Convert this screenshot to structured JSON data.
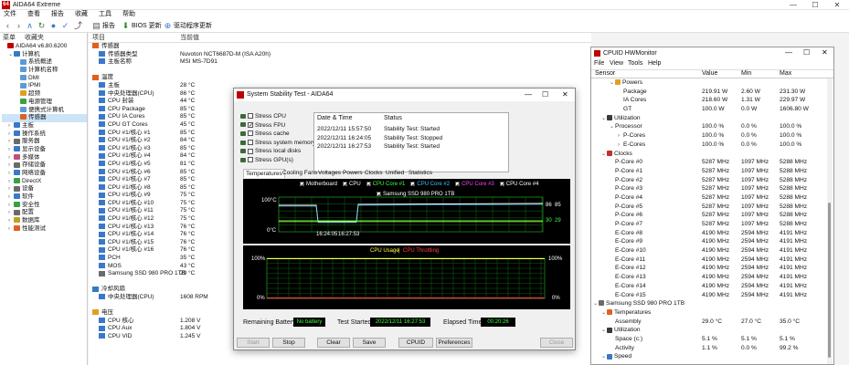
{
  "app": {
    "title": "AIDA64 Extreme",
    "icon_text": "64",
    "menu": [
      "文件",
      "查看",
      "报告",
      "收藏",
      "工具",
      "帮助"
    ],
    "toolbar": {
      "report": "报告",
      "bios": "BIOS 更新",
      "driver": "驱动程序更新"
    }
  },
  "left": {
    "tabs": [
      "菜单",
      "收藏夹"
    ],
    "tree": [
      {
        "label": "AIDA64 v6.80.6200",
        "level": 0,
        "exp": "",
        "icon": "#c00000"
      },
      {
        "label": "计算机",
        "level": 1,
        "exp": "⌄",
        "icon": "#3a78c8"
      },
      {
        "label": "系统概述",
        "level": 2,
        "exp": "",
        "icon": "#5b9bd5"
      },
      {
        "label": "计算机名称",
        "level": 2,
        "exp": "",
        "icon": "#5b9bd5"
      },
      {
        "label": "DMI",
        "level": 2,
        "exp": "",
        "icon": "#5b9bd5"
      },
      {
        "label": "IPMI",
        "level": 2,
        "exp": "",
        "icon": "#5b9bd5"
      },
      {
        "label": "超频",
        "level": 2,
        "exp": "",
        "icon": "#e0a020"
      },
      {
        "label": "电源管理",
        "level": 2,
        "exp": "",
        "icon": "#3aa040"
      },
      {
        "label": "便携式计算机",
        "level": 2,
        "exp": "",
        "icon": "#5b9bd5"
      },
      {
        "label": "传感器",
        "level": 2,
        "exp": "",
        "icon": "#e06020",
        "selected": true
      },
      {
        "label": "主板",
        "level": 1,
        "exp": "›",
        "icon": "#3a78c8"
      },
      {
        "label": "操作系统",
        "level": 1,
        "exp": "›",
        "icon": "#3a78c8"
      },
      {
        "label": "服务器",
        "level": 1,
        "exp": "›",
        "icon": "#6a6a6a"
      },
      {
        "label": "显示设备",
        "level": 1,
        "exp": "›",
        "icon": "#3a78c8"
      },
      {
        "label": "多媒体",
        "level": 1,
        "exp": "›",
        "icon": "#c05080"
      },
      {
        "label": "存储设备",
        "level": 1,
        "exp": "›",
        "icon": "#6a6a6a"
      },
      {
        "label": "网络设备",
        "level": 1,
        "exp": "›",
        "icon": "#3a78c8"
      },
      {
        "label": "DirectX",
        "level": 1,
        "exp": "›",
        "icon": "#3aa040"
      },
      {
        "label": "设备",
        "level": 1,
        "exp": "›",
        "icon": "#6a6a6a"
      },
      {
        "label": "软件",
        "level": 1,
        "exp": "›",
        "icon": "#3a78c8"
      },
      {
        "label": "安全性",
        "level": 1,
        "exp": "›",
        "icon": "#3aa040"
      },
      {
        "label": "配置",
        "level": 1,
        "exp": "›",
        "icon": "#6a6a6a"
      },
      {
        "label": "数据库",
        "level": 1,
        "exp": "›",
        "icon": "#c0a020"
      },
      {
        "label": "性能测试",
        "level": 1,
        "exp": "›",
        "icon": "#e06020"
      }
    ]
  },
  "center": {
    "col_item": "项目",
    "col_value": "当前值",
    "rows": [
      {
        "item": "传感器",
        "value": "",
        "group": true,
        "icon": "#e06020"
      },
      {
        "item": "传感器类型",
        "value": "Nuvoton NCT6687D-M  (ISA A20h)",
        "icon": "#3a78c8"
      },
      {
        "item": "主板名称",
        "value": "MSI MS-7D91",
        "icon": "#3a78c8"
      },
      {
        "item": "",
        "value": "",
        "spacer": true
      },
      {
        "item": "温度",
        "value": "",
        "group": true,
        "icon": "#e06020"
      },
      {
        "item": "主板",
        "value": "28 °C",
        "icon": "#3a78c8"
      },
      {
        "item": "中央处理器(CPU)",
        "value": "86 °C",
        "icon": "#3a78c8"
      },
      {
        "item": "CPU 封装",
        "value": "44 °C",
        "icon": "#3a78c8"
      },
      {
        "item": "CPU Package",
        "value": "85 °C",
        "icon": "#3a78c8"
      },
      {
        "item": "CPU IA Cores",
        "value": "85 °C",
        "icon": "#3a78c8"
      },
      {
        "item": "CPU GT Cores",
        "value": "45 °C",
        "icon": "#3a78c8"
      },
      {
        "item": "CPU #1/核心 #1",
        "value": "85 °C",
        "icon": "#3a78c8"
      },
      {
        "item": "CPU #1/核心 #2",
        "value": "84 °C",
        "icon": "#3a78c8"
      },
      {
        "item": "CPU #1/核心 #3",
        "value": "85 °C",
        "icon": "#3a78c8"
      },
      {
        "item": "CPU #1/核心 #4",
        "value": "84 °C",
        "icon": "#3a78c8"
      },
      {
        "item": "CPU #1/核心 #5",
        "value": "81 °C",
        "icon": "#3a78c8"
      },
      {
        "item": "CPU #1/核心 #6",
        "value": "85 °C",
        "icon": "#3a78c8"
      },
      {
        "item": "CPU #1/核心 #7",
        "value": "85 °C",
        "icon": "#3a78c8"
      },
      {
        "item": "CPU #1/核心 #8",
        "value": "85 °C",
        "icon": "#3a78c8"
      },
      {
        "item": "CPU #1/核心 #9",
        "value": "75 °C",
        "icon": "#3a78c8"
      },
      {
        "item": "CPU #1/核心 #10",
        "value": "75 °C",
        "icon": "#3a78c8"
      },
      {
        "item": "CPU #1/核心 #11",
        "value": "75 °C",
        "icon": "#3a78c8"
      },
      {
        "item": "CPU #1/核心 #12",
        "value": "75 °C",
        "icon": "#3a78c8"
      },
      {
        "item": "CPU #1/核心 #13",
        "value": "76 °C",
        "icon": "#3a78c8"
      },
      {
        "item": "CPU #1/核心 #14",
        "value": "76 °C",
        "icon": "#3a78c8"
      },
      {
        "item": "CPU #1/核心 #15",
        "value": "76 °C",
        "icon": "#3a78c8"
      },
      {
        "item": "CPU #1/核心 #16",
        "value": "76 °C",
        "icon": "#3a78c8"
      },
      {
        "item": "PCH",
        "value": "35 °C",
        "icon": "#3a78c8"
      },
      {
        "item": "MOS",
        "value": "43 °C",
        "icon": "#3a78c8"
      },
      {
        "item": "Samsung SSD 980 PRO 1TB",
        "value": "29 °C",
        "icon": "#6a6a6a"
      },
      {
        "item": "",
        "value": "",
        "spacer": true
      },
      {
        "item": "冷却风扇",
        "value": "",
        "group": true,
        "icon": "#3a78c8"
      },
      {
        "item": "中央处理器(CPU)",
        "value": "1608 RPM",
        "icon": "#3a78c8"
      },
      {
        "item": "",
        "value": "",
        "spacer": true
      },
      {
        "item": "电压",
        "value": "",
        "group": true,
        "icon": "#e0a020"
      },
      {
        "item": "CPU 核心",
        "value": "1.208 V",
        "icon": "#3a78c8"
      },
      {
        "item": "CPU Aux",
        "value": "1.804 V",
        "icon": "#3a78c8"
      },
      {
        "item": "CPU VID",
        "value": "1.245 V",
        "icon": "#3a78c8"
      }
    ]
  },
  "sst": {
    "title": "System Stability Test - AIDA64",
    "stress": [
      {
        "label": "Stress CPU",
        "checked": false
      },
      {
        "label": "Stress FPU",
        "checked": true
      },
      {
        "label": "Stress cache",
        "checked": false
      },
      {
        "label": "Stress system memory",
        "checked": false
      },
      {
        "label": "Stress local disks",
        "checked": false
      },
      {
        "label": "Stress GPU(s)",
        "checked": false
      }
    ],
    "log_head": {
      "date": "Date & Time",
      "status": "Status"
    },
    "log": [
      {
        "date": "2022/12/11 15:57:50",
        "status": "Stability Test: Started"
      },
      {
        "date": "2022/12/11 16:24:05",
        "status": "Stability Test: Stopped"
      },
      {
        "date": "2022/12/11 16:27:53",
        "status": "Stability Test: Started"
      }
    ],
    "tabs": [
      "Temperatures",
      "Cooling Fans",
      "Voltages",
      "Powers",
      "Clocks",
      "Unified",
      "Statistics"
    ],
    "temp_legend": [
      {
        "label": "Motherboard",
        "color": "#ffffff"
      },
      {
        "label": "CPU",
        "color": "#ffffff"
      },
      {
        "label": "CPU Core #1",
        "color": "#40ff40"
      },
      {
        "label": "CPU Core #2",
        "color": "#40c0ff"
      },
      {
        "label": "CPU Core #3",
        "color": "#ff40ff"
      },
      {
        "label": "CPU Core #4",
        "color": "#ffffff"
      }
    ],
    "ssd_legend": "Samsung SSD 980 PRO 1TB",
    "temp_ymax": "100°C",
    "temp_ymin": "0°C",
    "temp_t1": "16:24:05",
    "temp_t2": "16:27:53",
    "temp_r1": "86",
    "temp_r2": "85",
    "temp_r3": "30",
    "temp_r4": "29",
    "usage_title": "CPU Usage",
    "throttle_title": "CPU Throttling",
    "usage_ymax": "100%",
    "usage_ymin": "0%",
    "usage_r1": "100%",
    "usage_r2": "0%",
    "battery_label": "Remaining Battery:",
    "battery_value": "No battery",
    "started_label": "Test Started:",
    "started_value": "2022/12/11 16:27:53",
    "elapsed_label": "Elapsed Time:",
    "elapsed_value": "00:20:26",
    "buttons": {
      "start": "Start",
      "stop": "Stop",
      "clear": "Clear",
      "save": "Save",
      "cpuid": "CPUID",
      "prefs": "Preferences",
      "close": "Close"
    }
  },
  "hwm": {
    "title": "CPUID HWMonitor",
    "menu": [
      "File",
      "View",
      "Tools",
      "Help"
    ],
    "cols": {
      "sensor": "Sensor",
      "value": "Value",
      "min": "Min",
      "max": "Max"
    },
    "rows": [
      {
        "name": "Powers",
        "lvl": 2,
        "exp": "⌄",
        "icon": "#e0a020",
        "v": "",
        "mn": "",
        "mx": ""
      },
      {
        "name": "Package",
        "lvl": 3,
        "exp": "",
        "icon": "",
        "v": "219.91 W",
        "mn": "2.60 W",
        "mx": "231.30 W"
      },
      {
        "name": "IA Cores",
        "lvl": 3,
        "exp": "",
        "icon": "",
        "v": "218.60 W",
        "mn": "1.31 W",
        "mx": "229.97 W"
      },
      {
        "name": "GT",
        "lvl": 3,
        "exp": "",
        "icon": "",
        "v": "100.0 W",
        "mn": "0.0 W",
        "mx": "1606.80 W"
      },
      {
        "name": "Utilization",
        "lvl": 1,
        "exp": "⌄",
        "icon": "#3a3a3a",
        "v": "",
        "mn": "",
        "mx": ""
      },
      {
        "name": "Processor",
        "lvl": 2,
        "exp": "⌄",
        "icon": "",
        "v": "100.0 %",
        "mn": "0.0 %",
        "mx": "100.0 %"
      },
      {
        "name": "P-Cores",
        "lvl": 3,
        "exp": "›",
        "icon": "",
        "v": "100.0 %",
        "mn": "0.0 %",
        "mx": "100.0 %"
      },
      {
        "name": "E-Cores",
        "lvl": 3,
        "exp": "›",
        "icon": "",
        "v": "100.0 %",
        "mn": "0.0 %",
        "mx": "100.0 %"
      },
      {
        "name": "Clocks",
        "lvl": 1,
        "exp": "⌄",
        "icon": "#c03030",
        "v": "",
        "mn": "",
        "mx": ""
      },
      {
        "name": "P-Core #0",
        "lvl": 2,
        "exp": "",
        "icon": "",
        "v": "5287 MHz",
        "mn": "1097 MHz",
        "mx": "5288 MHz"
      },
      {
        "name": "P-Core #1",
        "lvl": 2,
        "exp": "",
        "icon": "",
        "v": "5287 MHz",
        "mn": "1097 MHz",
        "mx": "5288 MHz"
      },
      {
        "name": "P-Core #2",
        "lvl": 2,
        "exp": "",
        "icon": "",
        "v": "5287 MHz",
        "mn": "1097 MHz",
        "mx": "5288 MHz"
      },
      {
        "name": "P-Core #3",
        "lvl": 2,
        "exp": "",
        "icon": "",
        "v": "5287 MHz",
        "mn": "1097 MHz",
        "mx": "5288 MHz"
      },
      {
        "name": "P-Core #4",
        "lvl": 2,
        "exp": "",
        "icon": "",
        "v": "5287 MHz",
        "mn": "1097 MHz",
        "mx": "5288 MHz"
      },
      {
        "name": "P-Core #5",
        "lvl": 2,
        "exp": "",
        "icon": "",
        "v": "5287 MHz",
        "mn": "1097 MHz",
        "mx": "5288 MHz"
      },
      {
        "name": "P-Core #6",
        "lvl": 2,
        "exp": "",
        "icon": "",
        "v": "5287 MHz",
        "mn": "1097 MHz",
        "mx": "5288 MHz"
      },
      {
        "name": "P-Core #7",
        "lvl": 2,
        "exp": "",
        "icon": "",
        "v": "5287 MHz",
        "mn": "1097 MHz",
        "mx": "5288 MHz"
      },
      {
        "name": "E-Core #8",
        "lvl": 2,
        "exp": "",
        "icon": "",
        "v": "4190 MHz",
        "mn": "2594 MHz",
        "mx": "4191 MHz"
      },
      {
        "name": "E-Core #9",
        "lvl": 2,
        "exp": "",
        "icon": "",
        "v": "4190 MHz",
        "mn": "2594 MHz",
        "mx": "4191 MHz"
      },
      {
        "name": "E-Core #10",
        "lvl": 2,
        "exp": "",
        "icon": "",
        "v": "4190 MHz",
        "mn": "2594 MHz",
        "mx": "4191 MHz"
      },
      {
        "name": "E-Core #11",
        "lvl": 2,
        "exp": "",
        "icon": "",
        "v": "4190 MHz",
        "mn": "2594 MHz",
        "mx": "4191 MHz"
      },
      {
        "name": "E-Core #12",
        "lvl": 2,
        "exp": "",
        "icon": "",
        "v": "4190 MHz",
        "mn": "2594 MHz",
        "mx": "4191 MHz"
      },
      {
        "name": "E-Core #13",
        "lvl": 2,
        "exp": "",
        "icon": "",
        "v": "4190 MHz",
        "mn": "2594 MHz",
        "mx": "4191 MHz"
      },
      {
        "name": "E-Core #14",
        "lvl": 2,
        "exp": "",
        "icon": "",
        "v": "4190 MHz",
        "mn": "2594 MHz",
        "mx": "4191 MHz"
      },
      {
        "name": "E-Core #15",
        "lvl": 2,
        "exp": "",
        "icon": "",
        "v": "4190 MHz",
        "mn": "2594 MHz",
        "mx": "4191 MHz"
      },
      {
        "name": "Samsung SSD 980 PRO 1TB",
        "lvl": 0,
        "exp": "⌄",
        "icon": "#6a6a6a",
        "v": "",
        "mn": "",
        "mx": ""
      },
      {
        "name": "Temperatures",
        "lvl": 1,
        "exp": "⌄",
        "icon": "#e06020",
        "v": "",
        "mn": "",
        "mx": ""
      },
      {
        "name": "Assembly",
        "lvl": 2,
        "exp": "",
        "icon": "",
        "v": "29.0 °C",
        "mn": "27.0 °C",
        "mx": "35.0 °C"
      },
      {
        "name": "Utilization",
        "lvl": 1,
        "exp": "⌄",
        "icon": "#3a3a3a",
        "v": "",
        "mn": "",
        "mx": ""
      },
      {
        "name": "Space (c:)",
        "lvl": 2,
        "exp": "",
        "icon": "",
        "v": "5.1 %",
        "mn": "5.1 %",
        "mx": "5.1 %"
      },
      {
        "name": "Activity",
        "lvl": 2,
        "exp": "",
        "icon": "",
        "v": "1.1 %",
        "mn": "0.0 %",
        "mx": "99.2 %"
      },
      {
        "name": "Speed",
        "lvl": 1,
        "exp": "⌄",
        "icon": "#3a78c8",
        "v": "",
        "mn": "",
        "mx": ""
      }
    ]
  }
}
